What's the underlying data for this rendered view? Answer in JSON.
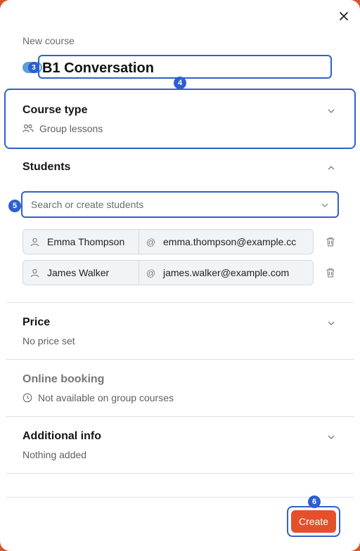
{
  "dialog": {
    "new_course_label": "New course",
    "course_name": "B1 Conversation",
    "create_label": "Create"
  },
  "course_type": {
    "title": "Course type",
    "value": "Group lessons"
  },
  "students": {
    "title": "Students",
    "search_placeholder": "Search or create students",
    "list": [
      {
        "name": "Emma Thompson",
        "email": "emma.thompson@example.cc"
      },
      {
        "name": "James Walker",
        "email": "james.walker@example.com"
      }
    ]
  },
  "price": {
    "title": "Price",
    "value": "No price set"
  },
  "online_booking": {
    "title": "Online booking",
    "value": "Not available on group courses"
  },
  "additional_info": {
    "title": "Additional info",
    "value": "Nothing added"
  },
  "annotations": {
    "badge_title": "3",
    "badge_course_type": "4",
    "badge_search": "5",
    "badge_create": "6"
  },
  "colors": {
    "accent": "#e5502a",
    "highlight": "#2f61c9",
    "toggle": "#5aa0d8"
  },
  "icons": [
    "close-icon",
    "group-icon",
    "chevron-down-icon",
    "chevron-up-icon",
    "user-icon",
    "at-icon",
    "trash-icon",
    "clock-icon"
  ]
}
